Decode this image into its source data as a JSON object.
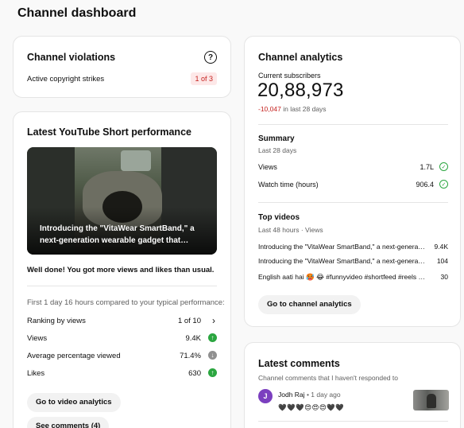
{
  "page_title": "Channel dashboard",
  "violations": {
    "title": "Channel violations",
    "help_icon": "?",
    "strikes_label": "Active copyright strikes",
    "strikes_value": "1 of 3"
  },
  "short_perf": {
    "title": "Latest YouTube Short performance",
    "video_caption": "Introducing the \"VitaWear SmartBand,\" a next-generation wearable gadget that…",
    "message": "Well done! You got more views and likes than usual.",
    "compare_text": "First 1 day 16 hours compared to your typical performance:",
    "metrics": [
      {
        "label": "Ranking by views",
        "value": "1 of 10"
      },
      {
        "label": "Views",
        "value": "9.4K",
        "trend": "up"
      },
      {
        "label": "Average percentage viewed",
        "value": "71.4%",
        "trend": "down"
      },
      {
        "label": "Likes",
        "value": "630",
        "trend": "up"
      }
    ],
    "go_analytics_label": "Go to video analytics",
    "see_comments_label": "See comments (4)"
  },
  "analytics": {
    "title": "Channel analytics",
    "subs_label": "Current subscribers",
    "subs_count": "20,88,973",
    "subs_change_value": "-10,047",
    "subs_change_period": "in last 28 days",
    "summary_title": "Summary",
    "summary_period": "Last 28 days",
    "summary_rows": [
      {
        "label": "Views",
        "value": "1.7L"
      },
      {
        "label": "Watch time (hours)",
        "value": "906.4"
      }
    ],
    "top_videos_title": "Top videos",
    "top_videos_period": "Last 48 hours · Views",
    "top_videos": [
      {
        "title": "Introducing the \"VitaWear SmartBand,\" a next-generation wearable gadget",
        "views": "9.4K"
      },
      {
        "title": "Introducing the \"VitaWear SmartBand,\" a next-generation wearable gadget",
        "views": "104"
      },
      {
        "title": "English aati hai 🥵 😂 #funnyvideo #shortfeed #reels #trending",
        "views": "30"
      }
    ],
    "go_channel_label": "Go to channel analytics"
  },
  "comments": {
    "title": "Latest comments",
    "subtitle": "Channel comments that I haven't responded to",
    "items": [
      {
        "avatar_letter": "J",
        "author": "Jodh Raj",
        "time": "• 1 day ago",
        "text": "🖤🖤🖤😍😍😍🖤🖤"
      }
    ]
  },
  "colors": {
    "accent_red": "#c5221f",
    "trend_up": "#2ba640",
    "avatar": "#7b3fbf"
  }
}
